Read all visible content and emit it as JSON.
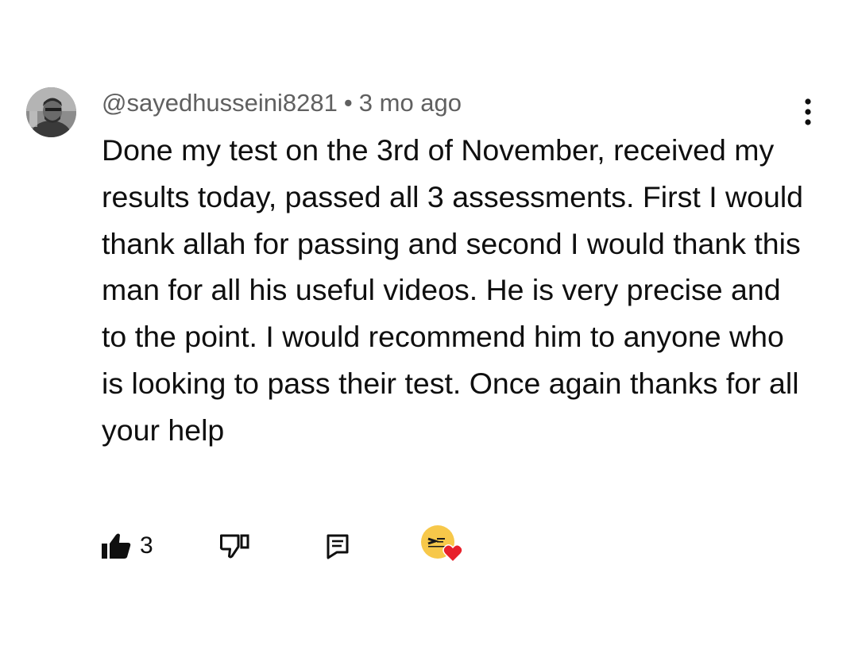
{
  "comment": {
    "author": "@sayedhusseini8281",
    "separator": "•",
    "time": "3 mo ago",
    "text": "Done my test on the 3rd of November, received my results today, passed all 3 assessments. First I would thank allah for passing and second I would thank this man for all his useful videos. He is very precise and to the point. I would recommend him to anyone who is looking to pass their test. Once again thanks for all your help",
    "like_count": "3"
  },
  "icons": {
    "avatar": "user-avatar-photo",
    "more": "more-vert-icon",
    "like": "thumb-up-filled-icon",
    "dislike": "thumb-down-outline-icon",
    "reply": "comment-reply-icon",
    "creator_heart": "creator-heart-badge"
  },
  "colors": {
    "text": "#0f0f0f",
    "secondary_text": "#606060",
    "heart": "#e8212b",
    "creator_logo_bg": "#f7c84a"
  }
}
